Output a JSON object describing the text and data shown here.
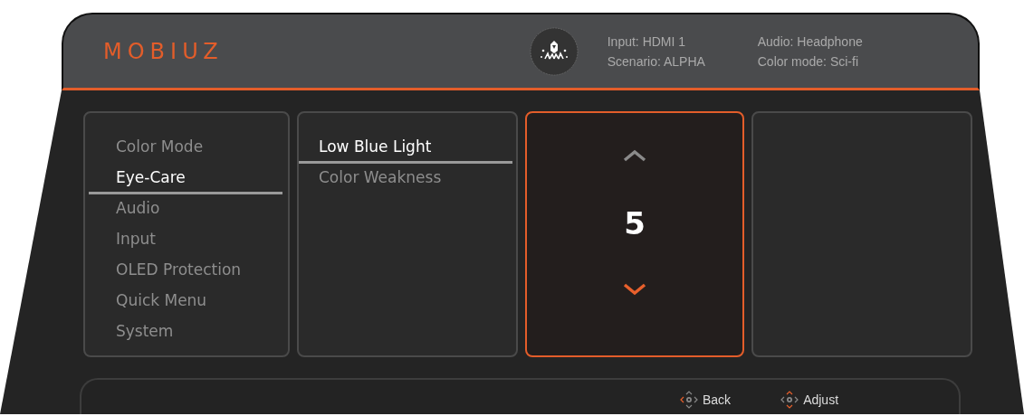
{
  "header": {
    "logo": "MOBIUZ",
    "info": [
      {
        "text": "Input: HDMI 1"
      },
      {
        "text": "Scenario: ALPHA"
      },
      {
        "text": "Audio: Headphone"
      },
      {
        "text": "Color mode: Sci-fi"
      }
    ]
  },
  "menu": [
    {
      "label": "Color Mode",
      "selected": false
    },
    {
      "label": "Eye-Care",
      "selected": true
    },
    {
      "label": "Audio",
      "selected": false
    },
    {
      "label": "Input",
      "selected": false
    },
    {
      "label": "OLED Protection",
      "selected": false
    },
    {
      "label": "Quick Menu",
      "selected": false
    },
    {
      "label": "System",
      "selected": false
    }
  ],
  "submenu": [
    {
      "label": "Low Blue Light",
      "selected": true
    },
    {
      "label": "Color Weakness",
      "selected": false
    }
  ],
  "value_panel": {
    "focused": true,
    "value": "5"
  },
  "hints": [
    {
      "label": "Back",
      "kind": "back"
    },
    {
      "label": "Adjust",
      "kind": "adjust"
    }
  ]
}
